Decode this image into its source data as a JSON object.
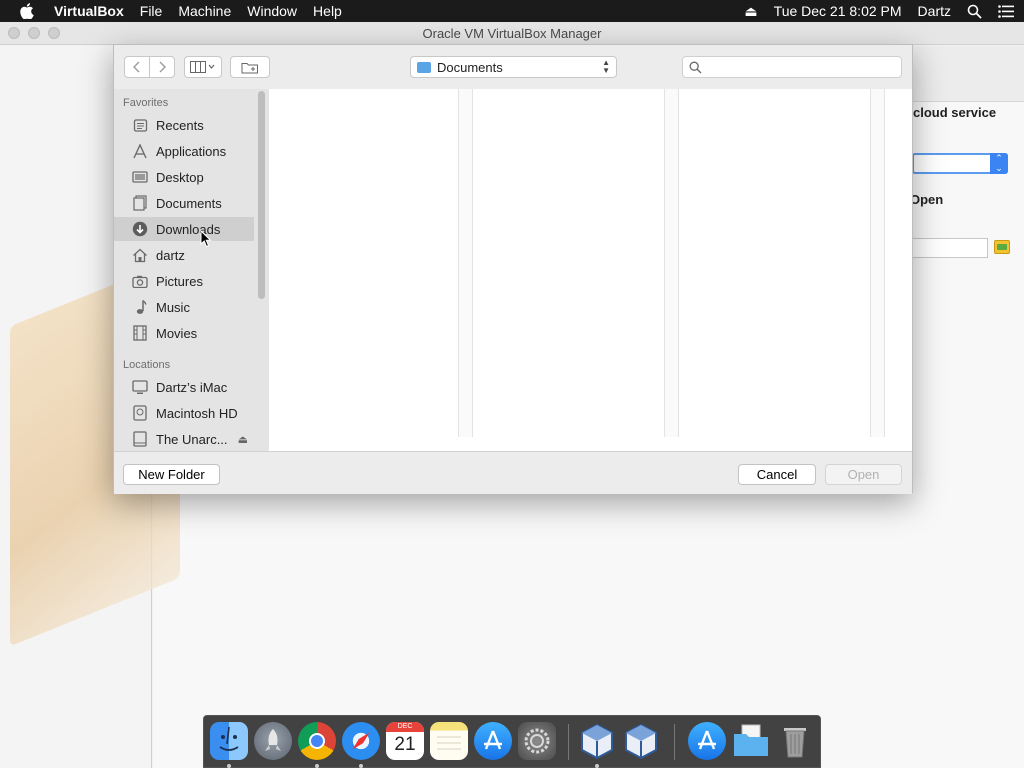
{
  "menubar": {
    "app_name": "VirtualBox",
    "items": [
      "File",
      "Machine",
      "Window",
      "Help"
    ],
    "datetime": "Tue Dec 21  8:02 PM",
    "user": "Dartz"
  },
  "vbox": {
    "window_title": "Oracle VM VirtualBox Manager",
    "cloud_label": "cloud service",
    "open_label": "Open"
  },
  "dialog": {
    "location": "Documents",
    "search_placeholder": "",
    "favorites_heading": "Favorites",
    "favorites": [
      {
        "label": "Recents",
        "icon": "recents-icon"
      },
      {
        "label": "Applications",
        "icon": "applications-icon"
      },
      {
        "label": "Desktop",
        "icon": "desktop-icon"
      },
      {
        "label": "Documents",
        "icon": "documents-icon"
      },
      {
        "label": "Downloads",
        "icon": "downloads-icon",
        "selected": true
      },
      {
        "label": "dartz",
        "icon": "home-icon"
      },
      {
        "label": "Pictures",
        "icon": "pictures-icon"
      },
      {
        "label": "Music",
        "icon": "music-icon"
      },
      {
        "label": "Movies",
        "icon": "movies-icon"
      }
    ],
    "locations_heading": "Locations",
    "locations": [
      {
        "label": "Dartz’s iMac",
        "icon": "imac-icon"
      },
      {
        "label": "Macintosh HD",
        "icon": "hard-drive-icon"
      },
      {
        "label": "The Unarc...",
        "icon": "disk-image-icon",
        "ejectable": true
      }
    ],
    "buttons": {
      "new_folder": "New Folder",
      "cancel": "Cancel",
      "open": "Open"
    }
  },
  "dock": {
    "calendar_month": "DEC",
    "calendar_day": "21",
    "apps": [
      "finder-icon",
      "launchpad-icon",
      "chrome-icon",
      "safari-icon",
      "calendar-icon",
      "notes-icon",
      "app-store-icon",
      "system-preferences-icon",
      "virtualbox-icon",
      "virtualbox-icon",
      "app-store-folder-icon",
      "downloads-folder-icon",
      "trash-icon"
    ]
  }
}
